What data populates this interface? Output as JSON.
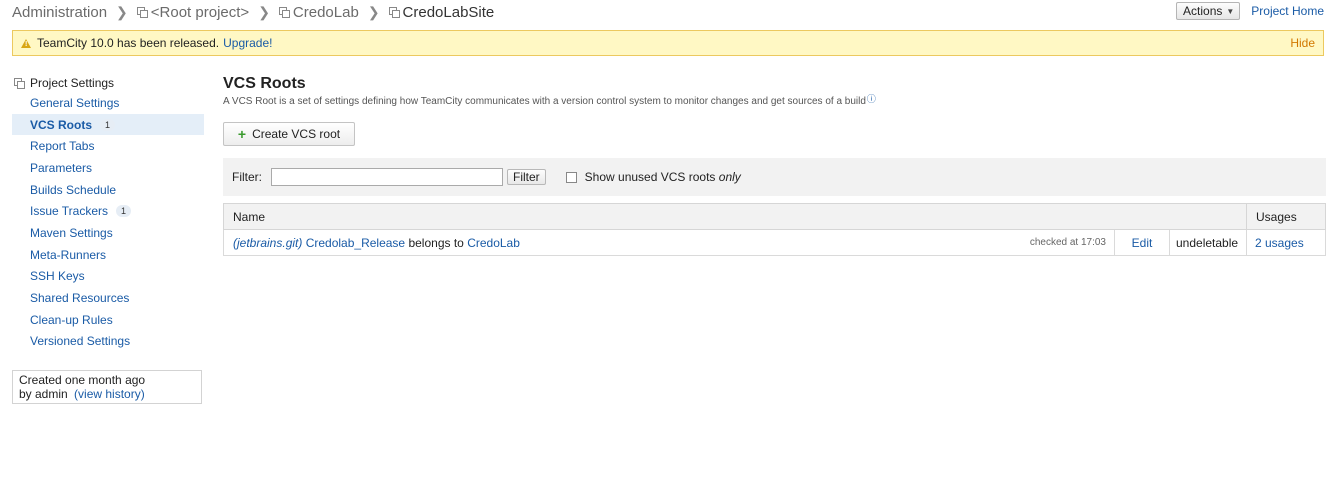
{
  "breadcrumbs": {
    "items": [
      "Administration",
      "<Root project>",
      "CredoLab",
      "CredoLabSite"
    ]
  },
  "header": {
    "actions_label": "Actions",
    "project_home_label": "Project Home"
  },
  "banner": {
    "message": "TeamCity 10.0 has been released.",
    "upgrade_label": "Upgrade!",
    "hide_label": "Hide"
  },
  "sidebar": {
    "title": "Project Settings",
    "items": [
      {
        "label": "General Settings",
        "badge": ""
      },
      {
        "label": "VCS Roots",
        "badge": "1"
      },
      {
        "label": "Report Tabs",
        "badge": ""
      },
      {
        "label": "Parameters",
        "badge": ""
      },
      {
        "label": "Builds Schedule",
        "badge": ""
      },
      {
        "label": "Issue Trackers",
        "badge": "1"
      },
      {
        "label": "Maven Settings",
        "badge": ""
      },
      {
        "label": "Meta-Runners",
        "badge": ""
      },
      {
        "label": "SSH Keys",
        "badge": ""
      },
      {
        "label": "Shared Resources",
        "badge": ""
      },
      {
        "label": "Clean-up Rules",
        "badge": ""
      },
      {
        "label": "Versioned Settings",
        "badge": ""
      }
    ],
    "created_text": "Created one month ago",
    "by_text": "by admin",
    "view_history_label": "(view history)"
  },
  "main": {
    "title": "VCS Roots",
    "description": "A VCS Root is a set of settings defining how TeamCity communicates with a version control system to monitor changes and get sources of a build",
    "create_button_label": "Create VCS root",
    "filter": {
      "label": "Filter:",
      "value": "",
      "button_label": "Filter",
      "show_unused_label": "Show unused VCS roots",
      "show_unused_emph": "only"
    },
    "table": {
      "headers": {
        "name": "Name",
        "usages": "Usages"
      },
      "rows": [
        {
          "type": "(jetbrains.git)",
          "name": "Credolab_Release",
          "belongs_to_text": "belongs to",
          "project": "CredoLab",
          "checked": "checked at 17:03",
          "edit_label": "Edit",
          "deletable": "undeletable",
          "usages": "2 usages"
        }
      ]
    }
  },
  "colors": {
    "link": "#1a5ba6",
    "banner_bg": "#fff8c4",
    "banner_border": "#ecc95f",
    "hide": "#d27800",
    "active_bg": "#e4eef8"
  }
}
